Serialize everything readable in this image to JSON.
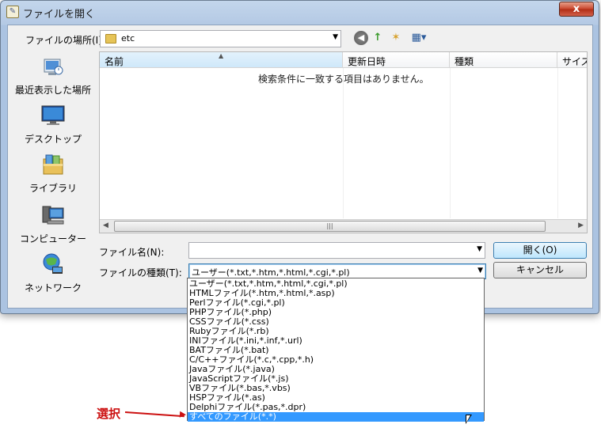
{
  "window": {
    "title": "ファイルを開く",
    "close_label": "x"
  },
  "location": {
    "label": "ファイルの場所(I):",
    "value": "etc"
  },
  "toolbar": {
    "back": "◀",
    "up": "↑",
    "new_folder": "✶",
    "view": "▦▾"
  },
  "places": [
    {
      "label": "最近表示した場所",
      "icon": "recent-places-icon"
    },
    {
      "label": "デスクトップ",
      "icon": "desktop-icon"
    },
    {
      "label": "ライブラリ",
      "icon": "libraries-icon"
    },
    {
      "label": "コンピューター",
      "icon": "computer-icon"
    },
    {
      "label": "ネットワーク",
      "icon": "network-icon"
    }
  ],
  "filelist": {
    "columns": [
      "名前",
      "更新日時",
      "種類",
      "サイズ"
    ],
    "empty_message": "検索条件に一致する項目はありません。"
  },
  "filename": {
    "label": "ファイル名(N):",
    "value": ""
  },
  "filetype": {
    "label": "ファイルの種類(T):",
    "value": "ユーザー(*.txt,*.htm,*.html,*.cgi,*.pl)",
    "options": [
      "ユーザー(*.txt,*.htm,*.html,*.cgi,*.pl)",
      "HTMLファイル(*.htm,*.html,*.asp)",
      "Perlファイル(*.cgi,*.pl)",
      "PHPファイル(*.php)",
      "CSSファイル(*.css)",
      "Rubyファイル(*.rb)",
      "INIファイル(*.ini,*.inf,*.url)",
      "BATファイル(*.bat)",
      "C/C++ファイル(*.c,*.cpp,*.h)",
      "Javaファイル(*.java)",
      "JavaScriptファイル(*.js)",
      "VBファイル(*.bas,*.vbs)",
      "HSPファイル(*.as)",
      "Delphiファイル(*.pas,*.dpr)",
      "すべてのファイル(*.*)"
    ],
    "selected_index": 14
  },
  "buttons": {
    "open": "開く(O)",
    "cancel": "キャンセル"
  },
  "annotation": {
    "text": "選択"
  }
}
